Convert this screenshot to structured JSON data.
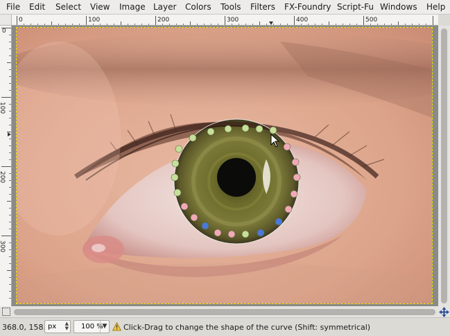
{
  "menubar": {
    "items": [
      "File",
      "Edit",
      "Select",
      "View",
      "Image",
      "Layer",
      "Colors",
      "Tools",
      "Filters",
      "FX-Foundry",
      "Script-Fu",
      "Windows",
      "Help"
    ]
  },
  "rulers": {
    "horizontal_labels": [
      "0",
      "100",
      "200",
      "300",
      "400",
      "500"
    ],
    "vertical_labels": [
      "0",
      "100",
      "200",
      "300"
    ]
  },
  "statusbar": {
    "coords": "368.0, 158.0",
    "unit": "px",
    "zoom": "100 %",
    "message": "Click-Drag to change the shape of the curve (Shift: symmetrical)"
  },
  "colors": {
    "accent_handle_green": "#c8df9a",
    "accent_handle_pink": "#f2a9b7",
    "accent_handle_blue": "#4a79d8",
    "selection_marching_ants": "#f2e200"
  }
}
